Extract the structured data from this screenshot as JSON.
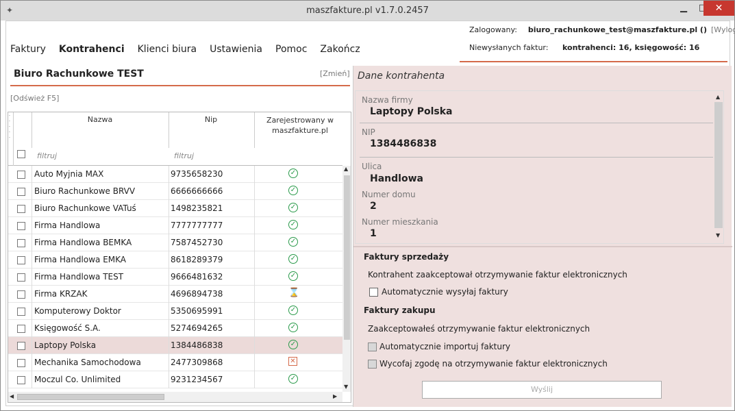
{
  "window": {
    "title": "maszfakture.pl  v1.7.0.2457"
  },
  "menu": [
    {
      "label": "Faktury",
      "active": false
    },
    {
      "label": "Kontrahenci",
      "active": true
    },
    {
      "label": "Klienci biura",
      "active": false
    },
    {
      "label": "Ustawienia",
      "active": false
    },
    {
      "label": "Pomoc",
      "active": false
    },
    {
      "label": "Zakończ",
      "active": false
    }
  ],
  "header": {
    "logged_label": "Zalogowany:",
    "user": "biuro_rachunkowe_test@maszfakture.pl ()",
    "logout": "[Wyloguj]",
    "unsent_label": "Niewysłanych faktur:",
    "unsent_value": "kontrahenci: 16, księgowość: 16"
  },
  "left": {
    "company": "Biuro Rachunkowe TEST",
    "change": "[Zmień]",
    "refresh": "[Odśwież F5]",
    "columns": {
      "name": "Nazwa",
      "nip": "Nip",
      "reg": "Zarejestrowany w maszfakture.pl"
    },
    "filter_placeholder": "filtruj",
    "rows": [
      {
        "name": "Auto Myjnia MAX",
        "nip": "9735658230",
        "status": "ok"
      },
      {
        "name": "Biuro Rachunkowe BRVV",
        "nip": "6666666666",
        "status": "ok"
      },
      {
        "name": "Biuro Rachunkowe VATuś",
        "nip": "1498235821",
        "status": "ok"
      },
      {
        "name": "Firma Handlowa",
        "nip": "7777777777",
        "status": "ok"
      },
      {
        "name": "Firma Handlowa BEMKA",
        "nip": "7587452730",
        "status": "ok"
      },
      {
        "name": "Firma Handlowa EMKA",
        "nip": "8618289379",
        "status": "ok"
      },
      {
        "name": "Firma Handlowa TEST",
        "nip": "9666481632",
        "status": "ok"
      },
      {
        "name": "Firma KRZAK",
        "nip": "4696894738",
        "status": "pending"
      },
      {
        "name": "Komputerowy Doktor",
        "nip": "5350695991",
        "status": "ok"
      },
      {
        "name": "Księgowość S.A.",
        "nip": "5274694265",
        "status": "ok"
      },
      {
        "name": "Laptopy Polska",
        "nip": "1384486838",
        "status": "ok",
        "selected": true
      },
      {
        "name": "Mechanika Samochodowa",
        "nip": "2477309868",
        "status": "error"
      },
      {
        "name": "Moczul Co. Unlimited",
        "nip": "9231234567",
        "status": "ok"
      }
    ]
  },
  "right": {
    "title": "Dane kontrahenta",
    "fields": [
      {
        "label": "Nazwa firmy",
        "value": "Laptopy Polska"
      },
      {
        "label": "NIP",
        "value": "1384486838"
      },
      {
        "label": "Ulica",
        "value": "Handlowa"
      },
      {
        "label": "Numer domu",
        "value": "2"
      },
      {
        "label": "Numer mieszkania",
        "value": "1"
      }
    ],
    "sales_title": "Faktury sprzedaży",
    "sales_text": "Kontrahent zaakceptował otrzymywanie faktur elektronicznych",
    "sales_auto": "Automatycznie wysyłaj faktury",
    "purchase_title": "Faktury zakupu",
    "purchase_text": "Zaakceptowałeś otrzymywanie faktur elektronicznych",
    "purchase_import": "Automatycznie importuj faktury",
    "purchase_withdraw": "Wycofaj zgodę na otrzymywanie faktur elektronicznych",
    "send_button": "Wyślij"
  }
}
